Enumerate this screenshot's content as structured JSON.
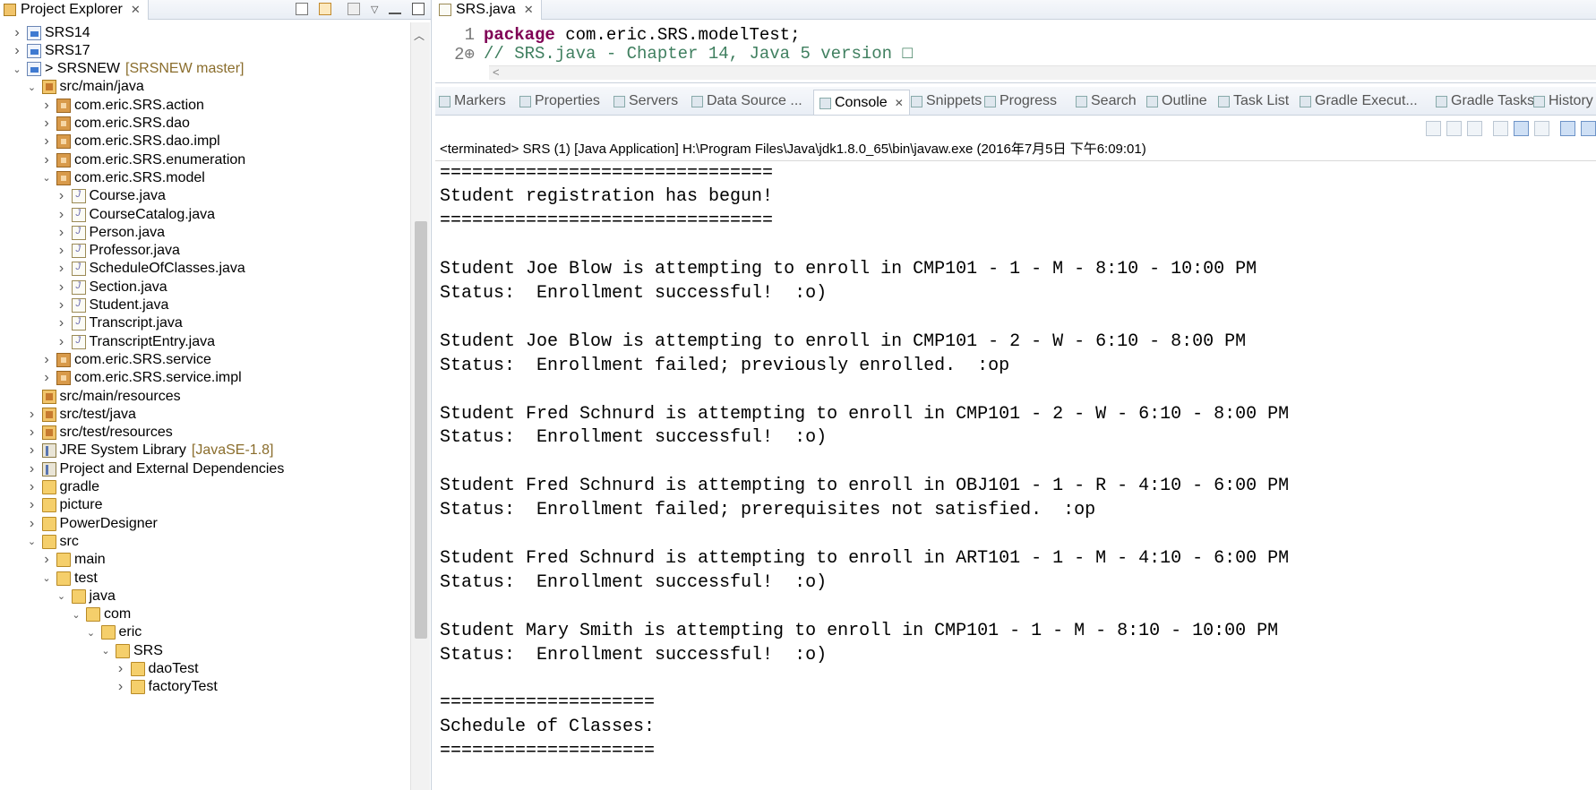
{
  "explorer": {
    "title": "Project Explorer",
    "tree": [
      {
        "label": "SRS14",
        "deco": "",
        "depth": 0,
        "twisty": "closed",
        "icon": "project-icon"
      },
      {
        "label": "SRS17",
        "deco": "",
        "depth": 0,
        "twisty": "closed",
        "icon": "project-icon"
      },
      {
        "label": "> SRSNEW",
        "deco": "[SRSNEW master]",
        "depth": 0,
        "twisty": "open",
        "icon": "project-icon"
      },
      {
        "label": "src/main/java",
        "deco": "",
        "depth": 1,
        "twisty": "open",
        "icon": "source-folder-icon"
      },
      {
        "label": "com.eric.SRS.action",
        "deco": "",
        "depth": 2,
        "twisty": "closed",
        "icon": "package-icon"
      },
      {
        "label": "com.eric.SRS.dao",
        "deco": "",
        "depth": 2,
        "twisty": "closed",
        "icon": "package-icon"
      },
      {
        "label": "com.eric.SRS.dao.impl",
        "deco": "",
        "depth": 2,
        "twisty": "closed",
        "icon": "package-icon"
      },
      {
        "label": "com.eric.SRS.enumeration",
        "deco": "",
        "depth": 2,
        "twisty": "closed",
        "icon": "package-icon"
      },
      {
        "label": "com.eric.SRS.model",
        "deco": "",
        "depth": 2,
        "twisty": "open",
        "icon": "package-icon"
      },
      {
        "label": "Course.java",
        "deco": "",
        "depth": 3,
        "twisty": "closed",
        "icon": "java-file-icon"
      },
      {
        "label": "CourseCatalog.java",
        "deco": "",
        "depth": 3,
        "twisty": "closed",
        "icon": "java-file-icon"
      },
      {
        "label": "Person.java",
        "deco": "",
        "depth": 3,
        "twisty": "closed",
        "icon": "java-file-icon"
      },
      {
        "label": "Professor.java",
        "deco": "",
        "depth": 3,
        "twisty": "closed",
        "icon": "java-file-icon"
      },
      {
        "label": "ScheduleOfClasses.java",
        "deco": "",
        "depth": 3,
        "twisty": "closed",
        "icon": "java-file-icon"
      },
      {
        "label": "Section.java",
        "deco": "",
        "depth": 3,
        "twisty": "closed",
        "icon": "java-file-icon"
      },
      {
        "label": "Student.java",
        "deco": "",
        "depth": 3,
        "twisty": "closed",
        "icon": "java-file-icon"
      },
      {
        "label": "Transcript.java",
        "deco": "",
        "depth": 3,
        "twisty": "closed",
        "icon": "java-file-icon"
      },
      {
        "label": "TranscriptEntry.java",
        "deco": "",
        "depth": 3,
        "twisty": "closed",
        "icon": "java-file-icon"
      },
      {
        "label": "com.eric.SRS.service",
        "deco": "",
        "depth": 2,
        "twisty": "closed",
        "icon": "package-icon"
      },
      {
        "label": "com.eric.SRS.service.impl",
        "deco": "",
        "depth": 2,
        "twisty": "closed",
        "icon": "package-icon"
      },
      {
        "label": "src/main/resources",
        "deco": "",
        "depth": 1,
        "twisty": "none",
        "icon": "source-folder-icon"
      },
      {
        "label": "src/test/java",
        "deco": "",
        "depth": 1,
        "twisty": "closed",
        "icon": "source-folder-icon"
      },
      {
        "label": "src/test/resources",
        "deco": "",
        "depth": 1,
        "twisty": "closed",
        "icon": "source-folder-icon"
      },
      {
        "label": "JRE System Library",
        "deco": "[JavaSE-1.8]",
        "depth": 1,
        "twisty": "closed",
        "icon": "library-icon"
      },
      {
        "label": "Project and External Dependencies",
        "deco": "",
        "depth": 1,
        "twisty": "closed",
        "icon": "library-icon"
      },
      {
        "label": "gradle",
        "deco": "",
        "depth": 1,
        "twisty": "closed",
        "icon": "folder-icon"
      },
      {
        "label": "picture",
        "deco": "",
        "depth": 1,
        "twisty": "closed",
        "icon": "folder-icon"
      },
      {
        "label": "PowerDesigner",
        "deco": "",
        "depth": 1,
        "twisty": "closed",
        "icon": "folder-icon"
      },
      {
        "label": "src",
        "deco": "",
        "depth": 1,
        "twisty": "open",
        "icon": "folder-icon"
      },
      {
        "label": "main",
        "deco": "",
        "depth": 2,
        "twisty": "closed",
        "icon": "folder-icon"
      },
      {
        "label": "test",
        "deco": "",
        "depth": 2,
        "twisty": "open",
        "icon": "folder-icon"
      },
      {
        "label": "java",
        "deco": "",
        "depth": 3,
        "twisty": "open",
        "icon": "folder-icon"
      },
      {
        "label": "com",
        "deco": "",
        "depth": 4,
        "twisty": "open",
        "icon": "folder-icon"
      },
      {
        "label": "eric",
        "deco": "",
        "depth": 5,
        "twisty": "open",
        "icon": "folder-icon"
      },
      {
        "label": "SRS",
        "deco": "",
        "depth": 6,
        "twisty": "open",
        "icon": "folder-icon"
      },
      {
        "label": "daoTest",
        "deco": "",
        "depth": 7,
        "twisty": "closed",
        "icon": "folder-icon"
      },
      {
        "label": "factoryTest",
        "deco": "",
        "depth": 7,
        "twisty": "closed",
        "icon": "folder-icon"
      }
    ]
  },
  "editor": {
    "tab_label": "SRS.java",
    "lines": [
      {
        "num": "1",
        "keyword": "package",
        "text": " com.eric.SRS.modelTest;",
        "comment": ""
      },
      {
        "num": "2⊕",
        "keyword": "",
        "text": "",
        "comment": "// SRS.java - Chapter 14, Java 5 version □"
      }
    ],
    "hscroll_arrow": "<"
  },
  "views": {
    "tabs": [
      {
        "label": "Markers",
        "icon": "markers-icon",
        "active": false
      },
      {
        "label": "Properties",
        "icon": "properties-icon",
        "active": false
      },
      {
        "label": "Servers",
        "icon": "servers-icon",
        "active": false
      },
      {
        "label": "Data Source ...",
        "icon": "data-source-icon",
        "active": false
      },
      {
        "label": "Console",
        "icon": "console-icon",
        "active": true
      },
      {
        "label": "Snippets",
        "icon": "snippets-icon",
        "active": false
      },
      {
        "label": "Progress",
        "icon": "progress-icon",
        "active": false
      },
      {
        "label": "Search",
        "icon": "search-icon",
        "active": false
      },
      {
        "label": "Outline",
        "icon": "outline-icon",
        "active": false
      },
      {
        "label": "Task List",
        "icon": "task-list-icon",
        "active": false
      },
      {
        "label": "Gradle Execut...",
        "icon": "gradle-icon",
        "active": false
      },
      {
        "label": "Gradle Tasks",
        "icon": "gradle-icon",
        "active": false
      },
      {
        "label": "History",
        "icon": "history-icon",
        "active": false
      }
    ]
  },
  "console": {
    "status": "<terminated> SRS (1) [Java Application] H:\\Program Files\\Java\\jdk1.8.0_65\\bin\\javaw.exe (2016年7月5日 下午6:09:01)",
    "lines": [
      "===============================",
      "Student registration has begun!",
      "===============================",
      "",
      "Student Joe Blow is attempting to enroll in CMP101 - 1 - M - 8:10 - 10:00 PM",
      "Status:  Enrollment successful!  :o)",
      "",
      "Student Joe Blow is attempting to enroll in CMP101 - 2 - W - 6:10 - 8:00 PM",
      "Status:  Enrollment failed; previously enrolled.  :op",
      "",
      "Student Fred Schnurd is attempting to enroll in CMP101 - 2 - W - 6:10 - 8:00 PM",
      "Status:  Enrollment successful!  :o)",
      "",
      "Student Fred Schnurd is attempting to enroll in OBJ101 - 1 - R - 4:10 - 6:00 PM",
      "Status:  Enrollment failed; prerequisites not satisfied.  :op",
      "",
      "Student Fred Schnurd is attempting to enroll in ART101 - 1 - M - 4:10 - 6:00 PM",
      "Status:  Enrollment successful!  :o)",
      "",
      "Student Mary Smith is attempting to enroll in CMP101 - 1 - M - 8:10 - 10:00 PM",
      "Status:  Enrollment successful!  :o)",
      "",
      "====================",
      "Schedule of Classes:",
      "===================="
    ]
  },
  "colors": {
    "keyword": "#7f0055",
    "comment": "#3f7f5f",
    "decoration": "#8a6d2c",
    "tab_gradient_top": "#f6f8fb",
    "tab_gradient_bottom": "#e9eef5"
  }
}
